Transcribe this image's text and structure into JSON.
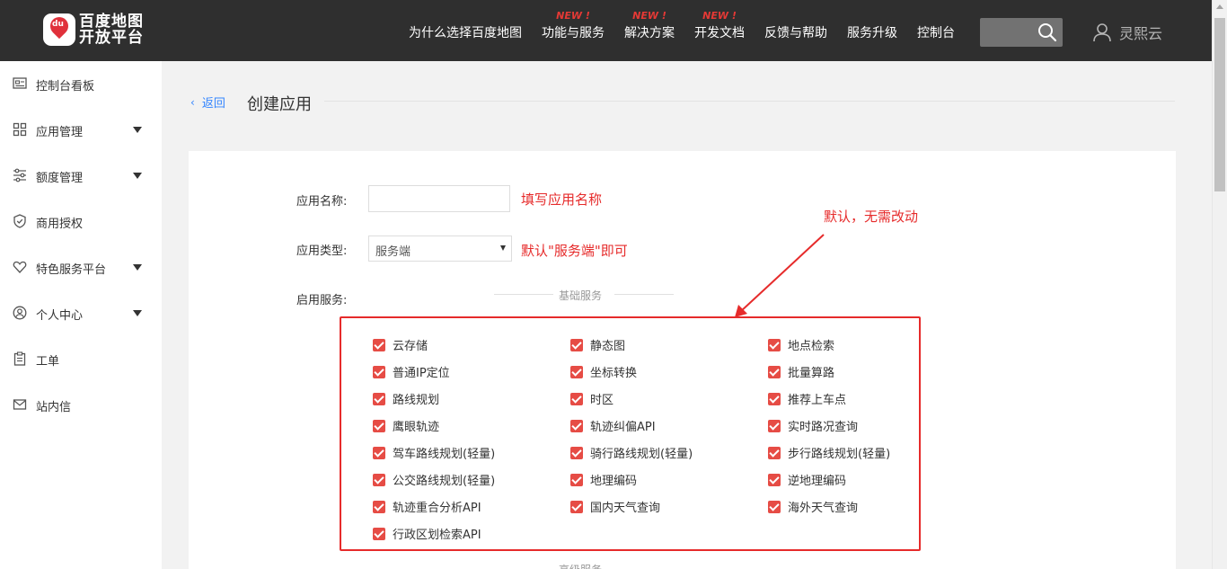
{
  "header": {
    "logo_line1": "百度地图",
    "logo_line2": "开放平台",
    "logo_badge": "du",
    "nav": [
      {
        "label": "为什么选择百度地图",
        "badge": ""
      },
      {
        "label": "功能与服务",
        "badge": "NEW !"
      },
      {
        "label": "解决方案",
        "badge": "NEW !"
      },
      {
        "label": "开发文档",
        "badge": "NEW !"
      },
      {
        "label": "反馈与帮助",
        "badge": ""
      },
      {
        "label": "服务升级",
        "badge": ""
      },
      {
        "label": "控制台",
        "badge": ""
      }
    ],
    "search_placeholder": "",
    "username": "灵熙云"
  },
  "sidebar": {
    "items": [
      {
        "label": "控制台看板",
        "icon": "dashboard-icon",
        "expandable": false
      },
      {
        "label": "应用管理",
        "icon": "grid-icon",
        "expandable": true
      },
      {
        "label": "额度管理",
        "icon": "sliders-icon",
        "expandable": true
      },
      {
        "label": "商用授权",
        "icon": "shield-check-icon",
        "expandable": false
      },
      {
        "label": "特色服务平台",
        "icon": "heart-icon",
        "expandable": true
      },
      {
        "label": "个人中心",
        "icon": "user-circle-icon",
        "expandable": true
      },
      {
        "label": "工单",
        "icon": "clipboard-icon",
        "expandable": false
      },
      {
        "label": "站内信",
        "icon": "mail-icon",
        "expandable": false
      }
    ]
  },
  "breadcrumb": {
    "back_label": "返回",
    "page_title": "创建应用"
  },
  "form": {
    "app_name_label": "应用名称:",
    "app_name_value": "",
    "app_type_label": "应用类型:",
    "app_type_value": "服务端",
    "services_label": "启用服务:",
    "basic_section_title": "基础服务",
    "next_section_title": "高级服务"
  },
  "annotations": {
    "name_hint": "填写应用名称",
    "type_hint": "默认\"服务端\"即可",
    "default_hint": "默认，无需改动",
    "color": "#e62b2b"
  },
  "services": [
    [
      "云存储",
      "静态图",
      "地点检索"
    ],
    [
      "普通IP定位",
      "坐标转换",
      "批量算路"
    ],
    [
      "路线规划",
      "时区",
      "推荐上车点"
    ],
    [
      "鹰眼轨迹",
      "轨迹纠偏API",
      "实时路况查询"
    ],
    [
      "驾车路线规划(轻量)",
      "骑行路线规划(轻量)",
      "步行路线规划(轻量)"
    ],
    [
      "公交路线规划(轻量)",
      "地理编码",
      "逆地理编码"
    ],
    [
      "轨迹重合分析API",
      "国内天气查询",
      "海外天气查询"
    ],
    [
      "行政区划检索API",
      "",
      ""
    ]
  ],
  "colors": {
    "topbar": "#2f2f2f",
    "checkbox": "#e64c45",
    "link": "#3385ff"
  }
}
